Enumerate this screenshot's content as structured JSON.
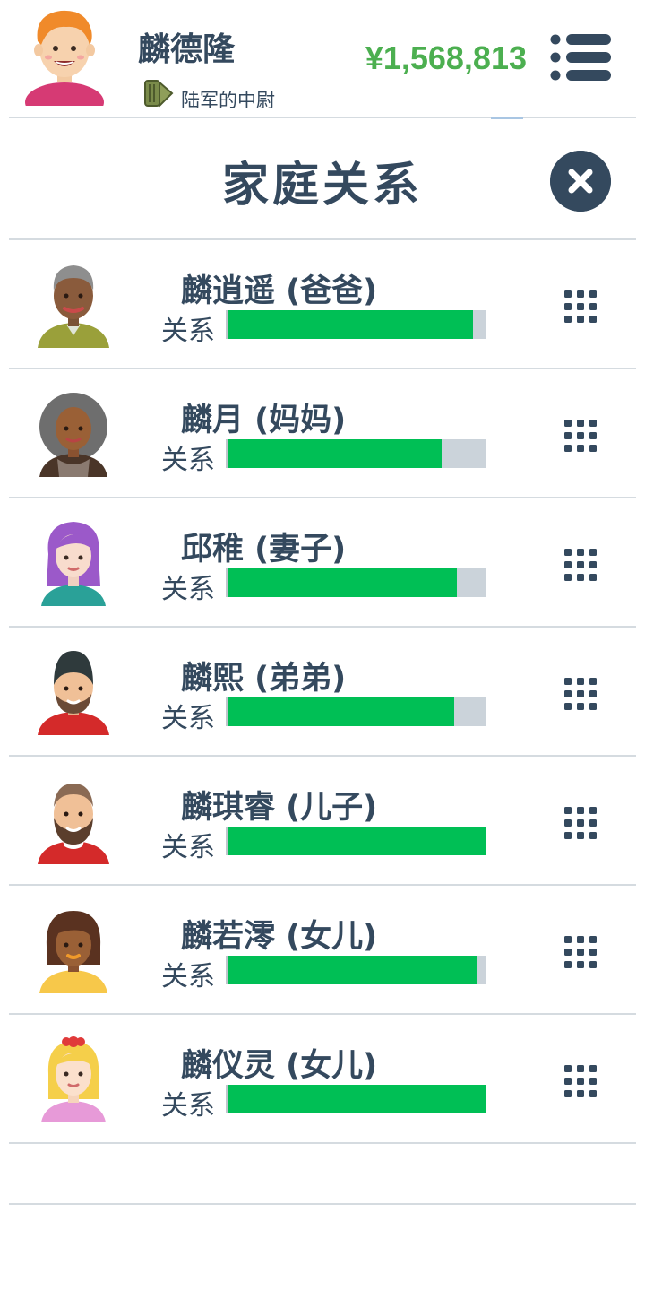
{
  "header": {
    "player_name": "麟德隆",
    "rank": "陆军的中尉",
    "money": "¥1,568,813",
    "avatar_icon": "man-avatar-icon",
    "rank_icon": "military-rank-icon",
    "menu_icon": "menu-icon"
  },
  "page": {
    "title": "家庭关系",
    "close_icon": "close-icon"
  },
  "relation_label": "关系",
  "colors": {
    "text": "#34495e",
    "money": "#4caf50",
    "bar_fill": "#00bf55",
    "bar_track": "#cbd3da"
  },
  "family": [
    {
      "name": "麟逍遥 (爸爸)",
      "relation_label": "关系",
      "relationship": 0.95,
      "avatar": "elderly-man-avatar-icon"
    },
    {
      "name": "麟月 (妈妈)",
      "relation_label": "关系",
      "relationship": 0.83,
      "avatar": "curly-hair-woman-avatar-icon"
    },
    {
      "name": "邱稚 (妻子)",
      "relation_label": "关系",
      "relationship": 0.89,
      "avatar": "purple-hair-woman-avatar-icon"
    },
    {
      "name": "麟熙 (弟弟)",
      "relation_label": "关系",
      "relationship": 0.88,
      "avatar": "bearded-man-beanie-avatar-icon"
    },
    {
      "name": "麟琪睿 (儿子)",
      "relation_label": "关系",
      "relationship": 1.0,
      "avatar": "bearded-man-avatar-icon"
    },
    {
      "name": "麟若澪 (女儿)",
      "relation_label": "关系",
      "relationship": 0.97,
      "avatar": "girl-bob-hair-avatar-icon"
    },
    {
      "name": "麟仪灵 (女儿)",
      "relation_label": "关系",
      "relationship": 1.0,
      "avatar": "blonde-girl-avatar-icon"
    }
  ]
}
